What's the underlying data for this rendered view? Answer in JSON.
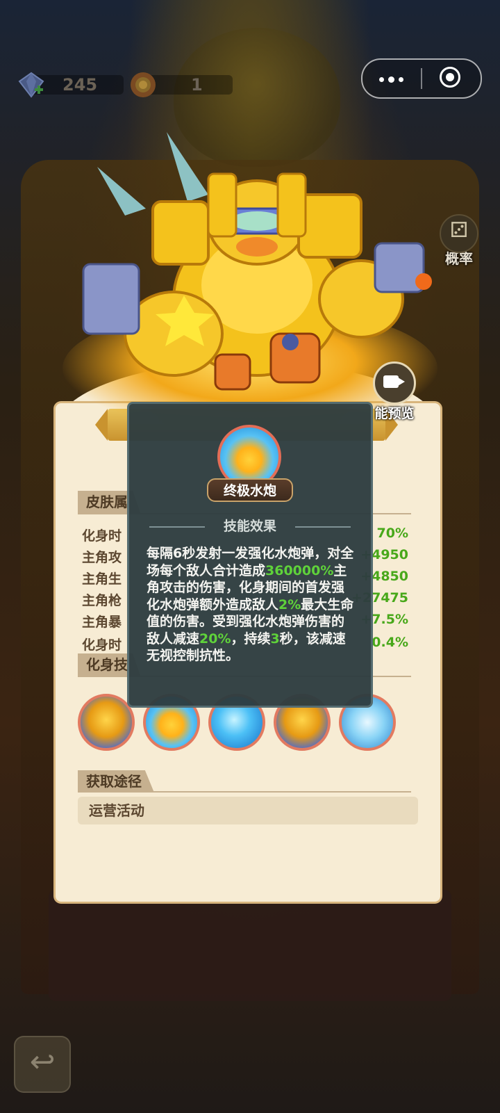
{
  "topbar": {
    "gems": "245",
    "flowers": "1",
    "menu_icon": "more-dots-icon",
    "close_icon": "target-circle-icon"
  },
  "side_buttons": {
    "probability_label": "概率",
    "skill_preview_label": "能预览"
  },
  "attributes": {
    "section_title": "皮肤属",
    "rows": [
      {
        "name": "化身时",
        "value": "70%"
      },
      {
        "name": "主角攻",
        "value": "+4950"
      },
      {
        "name": "主角生",
        "value": "+4850"
      },
      {
        "name": "主角枪",
        "value": "+27475"
      },
      {
        "name": "主角暴",
        "value": "+7.5%"
      },
      {
        "name": "化身时",
        "value": "0.4%"
      }
    ]
  },
  "skills": {
    "section_title": "化身技",
    "icons": [
      "mech-duck-icon",
      "duck-water-icon",
      "water-orb-icon",
      "mech-duck-icon",
      "ice-crystal-icon"
    ]
  },
  "source": {
    "section_title": "获取途径",
    "value": "运营活动"
  },
  "tooltip": {
    "skill_name": "终极水炮",
    "heading": "技能效果",
    "desc_1": "每隔6秒发射一发强化水炮弹，对全场每个敌人合计造成",
    "desc_2": "360000%",
    "desc_3": "主角攻击的伤害，化身期间的首发强化水炮弹额外造成敌人",
    "desc_4": "2%",
    "desc_5": "最大生命值的伤害。受到强化水炮弹伤害的敌人减速",
    "desc_6": "20%",
    "desc_7": "，持续",
    "desc_8": "3",
    "desc_9": "秒，该减速无视控制抗性。"
  }
}
